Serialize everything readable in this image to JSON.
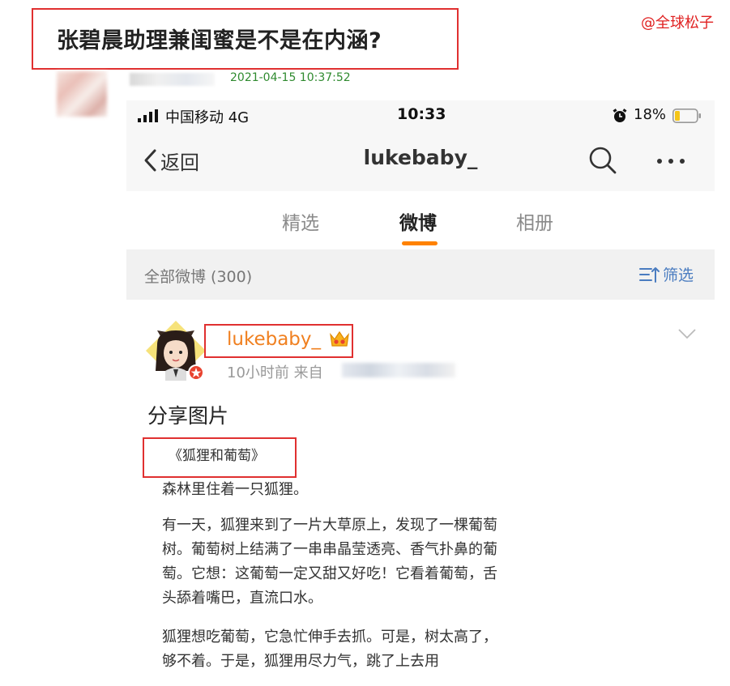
{
  "post": {
    "title": "张碧晨助理兼闺蜜是不是在内涵?",
    "watermark": "@全球松子",
    "timestamp": "2021-04-15 10:37:52"
  },
  "status_bar": {
    "carrier": "中国移动  4G",
    "time": "10:33",
    "battery": "18%"
  },
  "nav": {
    "back_label": "返回",
    "title": "lukebaby_"
  },
  "tabs": [
    {
      "label": "精选",
      "active": false
    },
    {
      "label": "微博",
      "active": true
    },
    {
      "label": "相册",
      "active": false
    }
  ],
  "filter": {
    "count_label": "全部微博 (300)",
    "filter_label": "筛选"
  },
  "weibo": {
    "user_name": "lukebaby_",
    "meta": "10小时前  来自",
    "heading": "分享图片",
    "story_title": "《狐狸和葡萄》",
    "paragraphs": [
      "森林里住着一只狐狸。",
      "有一天，狐狸来到了一片大草原上，发现了一棵葡萄树。葡萄树上结满了一串串晶莹透亮、香气扑鼻的葡萄。它想：这葡萄一定又甜又好吃！它看着葡萄，舌头舔着嘴巴，直流口水。",
      "狐狸想吃葡萄，它急忙伸手去抓。可是，树太高了，够不着。于是，狐狸用尽力气，跳了上去用"
    ]
  },
  "colors": {
    "accent_orange": "#ff8200",
    "username_orange": "#f08020",
    "annotation_red": "#e03030",
    "link_blue": "#4a7cc0",
    "timestamp_green": "#2f8a2f"
  },
  "icons": [
    "signal-icon",
    "alarm-icon",
    "battery-icon",
    "back-chevron-icon",
    "search-icon",
    "more-icon",
    "filter-icon",
    "crown-icon",
    "chevron-down-icon"
  ]
}
